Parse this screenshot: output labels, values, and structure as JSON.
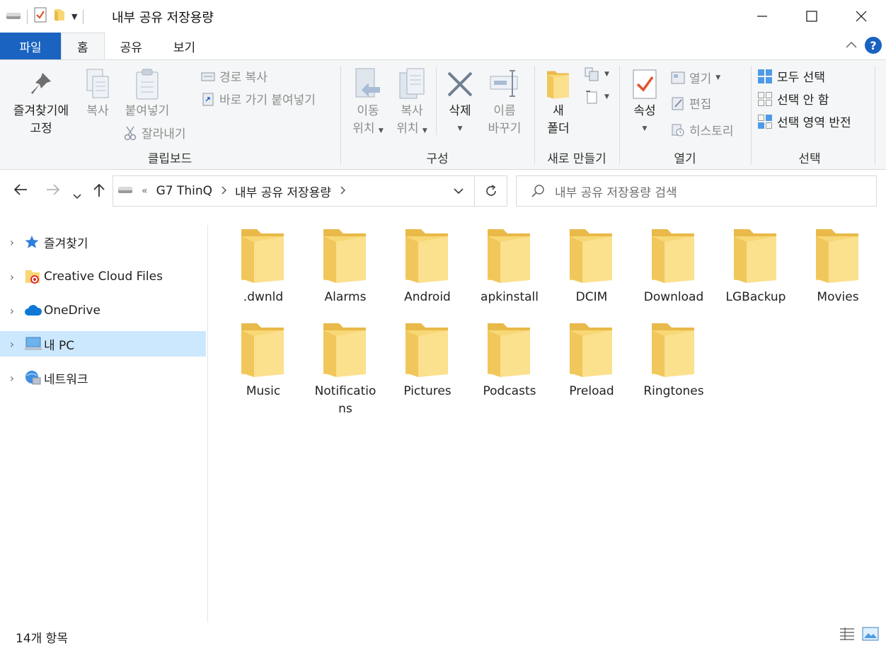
{
  "window": {
    "title": "내부 공유 저장용량"
  },
  "tabs": {
    "file": "파일",
    "home": "홈",
    "share": "공유",
    "view": "보기"
  },
  "ribbon": {
    "clipboard": {
      "label": "클립보드",
      "pin_line1": "즐겨찾기에",
      "pin_line2": "고정",
      "copy": "복사",
      "paste": "붙여넣기",
      "copy_path": "경로 복사",
      "paste_shortcut": "바로 가기 붙여넣기",
      "cut": "잘라내기"
    },
    "organize": {
      "label": "구성",
      "move_line1": "이동",
      "move_line2": "위치",
      "copyto_line1": "복사",
      "copyto_line2": "위치",
      "delete": "삭제",
      "rename_line1": "이름",
      "rename_line2": "바꾸기"
    },
    "new": {
      "label": "새로 만들기",
      "folder_line1": "새",
      "folder_line2": "폴더"
    },
    "open": {
      "label": "열기",
      "properties": "속성",
      "open": "열기",
      "edit": "편집",
      "history": "히스토리"
    },
    "select": {
      "label": "선택",
      "select_all": "모두 선택",
      "select_none": "선택 안 함",
      "invert": "선택 영역 반전"
    }
  },
  "address": {
    "overflow": "«",
    "crumbs": [
      "G7 ThinQ",
      "내부 공유 저장용량"
    ],
    "search_placeholder": "내부 공유 저장용량 검색"
  },
  "sidebar": {
    "items": [
      {
        "label": "즐겨찾기",
        "icon": "star-icon"
      },
      {
        "label": "Creative Cloud Files",
        "icon": "creative-cloud-folder-icon"
      },
      {
        "label": "OneDrive",
        "icon": "onedrive-cloud-icon"
      },
      {
        "label": "내 PC",
        "icon": "pc-icon",
        "selected": true
      },
      {
        "label": "네트워크",
        "icon": "network-icon"
      }
    ]
  },
  "folders": [
    {
      "name": ".dwnld"
    },
    {
      "name": "Alarms"
    },
    {
      "name": "Android"
    },
    {
      "name": "apkinstall"
    },
    {
      "name": "DCIM"
    },
    {
      "name": "Download"
    },
    {
      "name": "LGBackup"
    },
    {
      "name": "Movies"
    },
    {
      "name": "Music"
    },
    {
      "name": "Notifications"
    },
    {
      "name": "Pictures"
    },
    {
      "name": "Podcasts"
    },
    {
      "name": "Preload"
    },
    {
      "name": "Ringtones"
    }
  ],
  "status": {
    "item_count": "14개 항목"
  },
  "colors": {
    "accent": "#1a63c0",
    "selection": "#cce8ff",
    "folder": "#f8d775"
  }
}
